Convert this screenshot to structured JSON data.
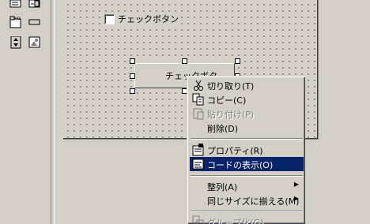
{
  "form": {
    "checkbox_label": "チェックボタン",
    "command_button_label": "チェックボタ"
  },
  "context_menu": {
    "items": [
      {
        "label": "切り取り(T)",
        "icon": "scissors-icon",
        "enabled": true
      },
      {
        "label": "コピー(C)",
        "icon": "copy-icon",
        "enabled": true
      },
      {
        "label": "貼り付け(P)",
        "icon": "paste-icon",
        "enabled": false
      },
      {
        "label": "削除(D)",
        "icon": "",
        "enabled": true
      },
      {
        "label": "プロパティ(R)",
        "icon": "properties-icon",
        "enabled": true
      },
      {
        "label": "コードの表示(O)",
        "icon": "view-code-icon",
        "enabled": true,
        "selected": true
      },
      {
        "label": "整列(A)",
        "icon": "",
        "enabled": true,
        "submenu": true
      },
      {
        "label": "同じサイズに揃える(M)",
        "icon": "",
        "enabled": true,
        "submenu": true
      },
      {
        "label": "グループ化(G)",
        "icon": "group-icon",
        "enabled": false
      }
    ],
    "submenu_arrow": "▶"
  },
  "colors": {
    "face": "#d4d0c8",
    "highlight": "#0a246a",
    "disabled_text": "#808080"
  }
}
